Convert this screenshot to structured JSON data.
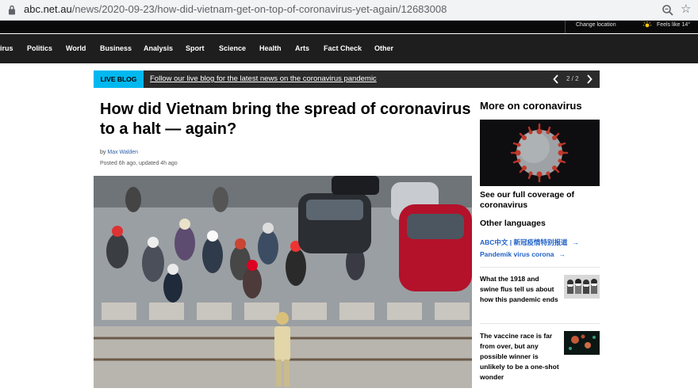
{
  "browser": {
    "url_host": "abc.net.au",
    "url_path": "/news/2020-09-23/how-did-vietnam-get-on-top-of-coronavirus-yet-again/12683008",
    "lock_icon": "lock-icon",
    "zoom_icon": "zoom-icon",
    "bookmark_icon": "star-icon"
  },
  "topstrip": {
    "change_location": "Change location",
    "weather": "Feels like 14°"
  },
  "nav": {
    "items": [
      "irus",
      "Politics",
      "World",
      "Business",
      "Analysis",
      "Sport",
      "Science",
      "Health",
      "Arts",
      "Fact Check",
      "Other"
    ]
  },
  "liveblog": {
    "tag": "LIVE BLOG",
    "message": "Follow our live blog for the latest news on the coronavirus pandemic",
    "pager": "2 / 2"
  },
  "article": {
    "headline": "How did Vietnam bring the spread of coronavirus to a halt — again?",
    "by": "by",
    "author": "Max Walden",
    "posted": "Posted 6h ago, updated 4h ago"
  },
  "sidebar": {
    "heading": "More on coronavirus",
    "coverage_link": "See our full coverage of coronavirus",
    "languages_heading": "Other languages",
    "languages": [
      "ABC中文 | 新冠疫情特别报道",
      "Pandemik virus corona"
    ],
    "stories": [
      "What the 1918 and swine flus tell us about how this pandemic ends",
      "The vaccine race is far from over, but any possible winner is unlikely to be a one-shot wonder"
    ]
  },
  "colors": {
    "accent_blue": "#00b8f0",
    "link_blue": "#2162c7",
    "nav_bg": "#1e1e1e"
  }
}
